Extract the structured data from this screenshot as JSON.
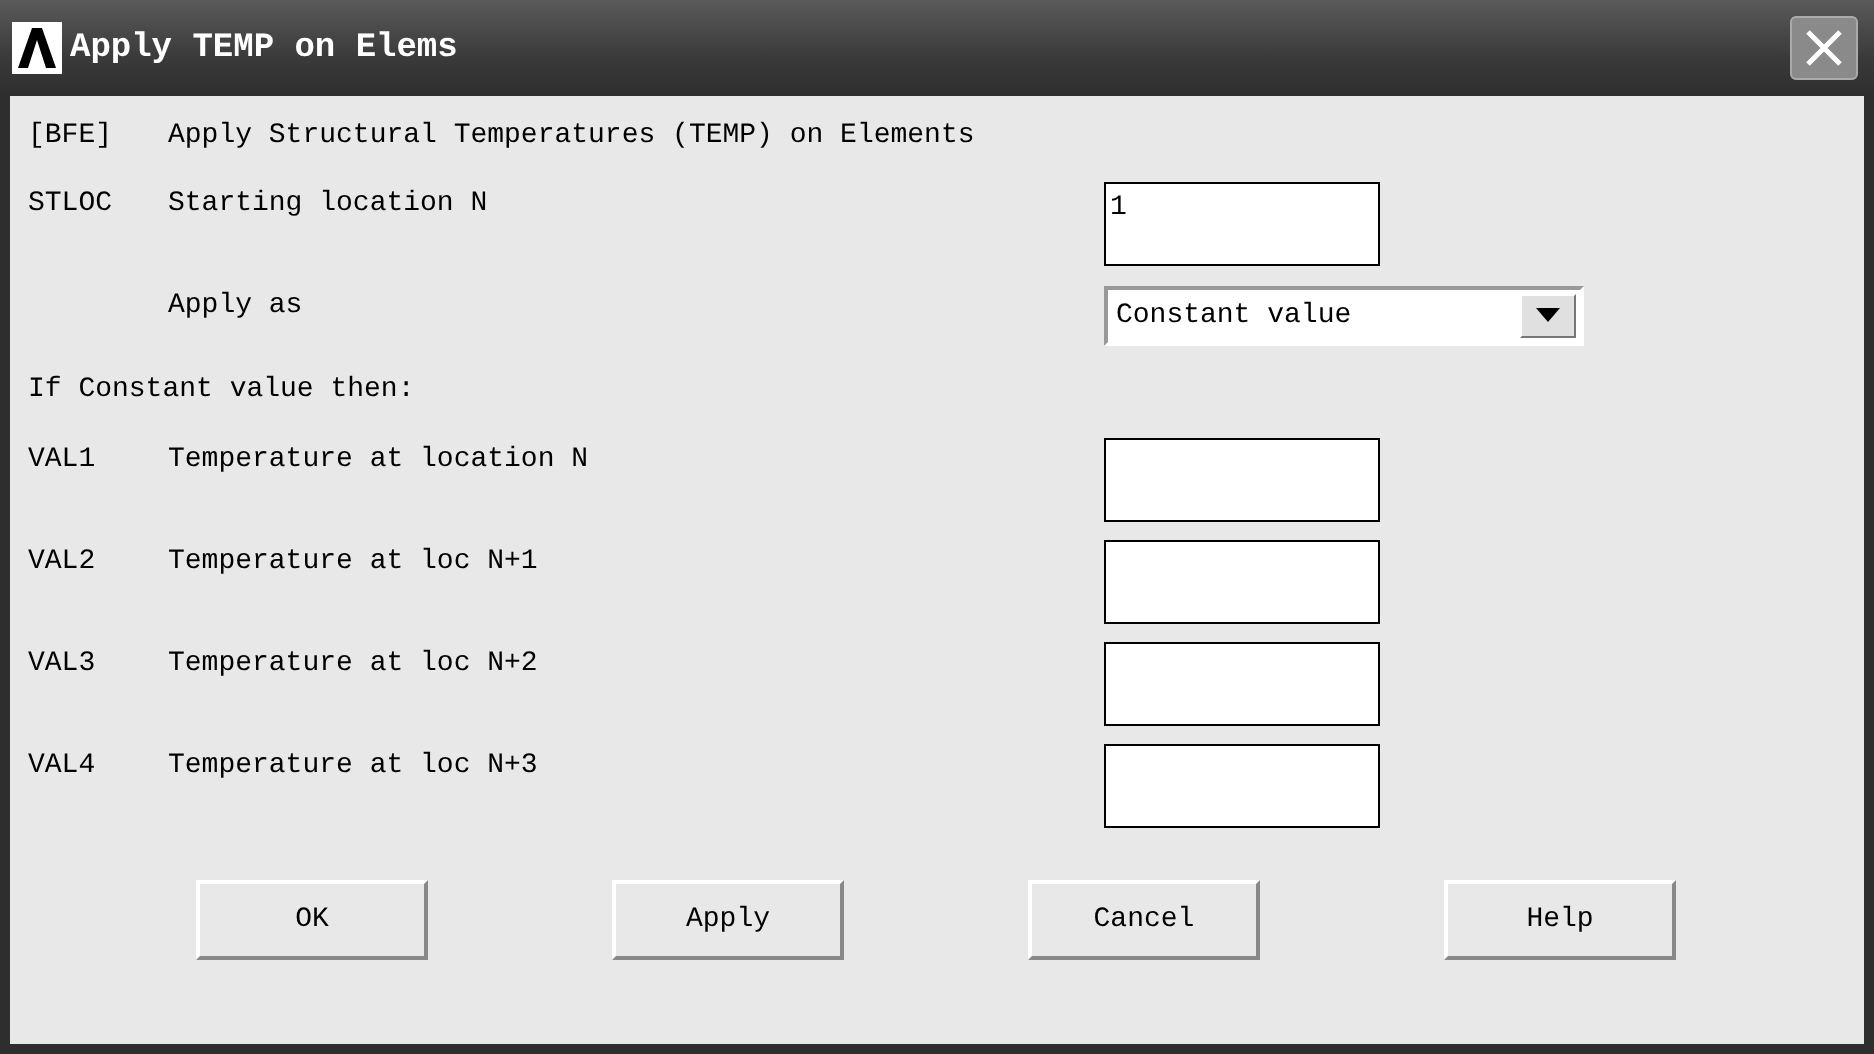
{
  "window": {
    "title": "Apply TEMP on Elems"
  },
  "command": {
    "code": "[BFE]",
    "text": "Apply Structural Temperatures (TEMP) on Elements"
  },
  "fields": [
    {
      "kind": "text",
      "code": "STLOC",
      "label": "Starting location N",
      "value": "1"
    },
    {
      "kind": "dropdown",
      "label": "Apply as",
      "value": "Constant value"
    },
    {
      "kind": "heading",
      "label": "If Constant value then:"
    },
    {
      "kind": "text",
      "code": "VAL1",
      "label": "Temperature at location N"
    },
    {
      "kind": "text",
      "code": "VAL2",
      "label": "Temperature at loc N+1"
    },
    {
      "kind": "text",
      "code": "VAL3",
      "label": "Temperature at loc N+2"
    },
    {
      "kind": "text",
      "code": "VAL4",
      "label": "Temperature at loc N+3"
    }
  ],
  "buttons": [
    "OK",
    "Apply",
    "Cancel",
    "Help"
  ]
}
